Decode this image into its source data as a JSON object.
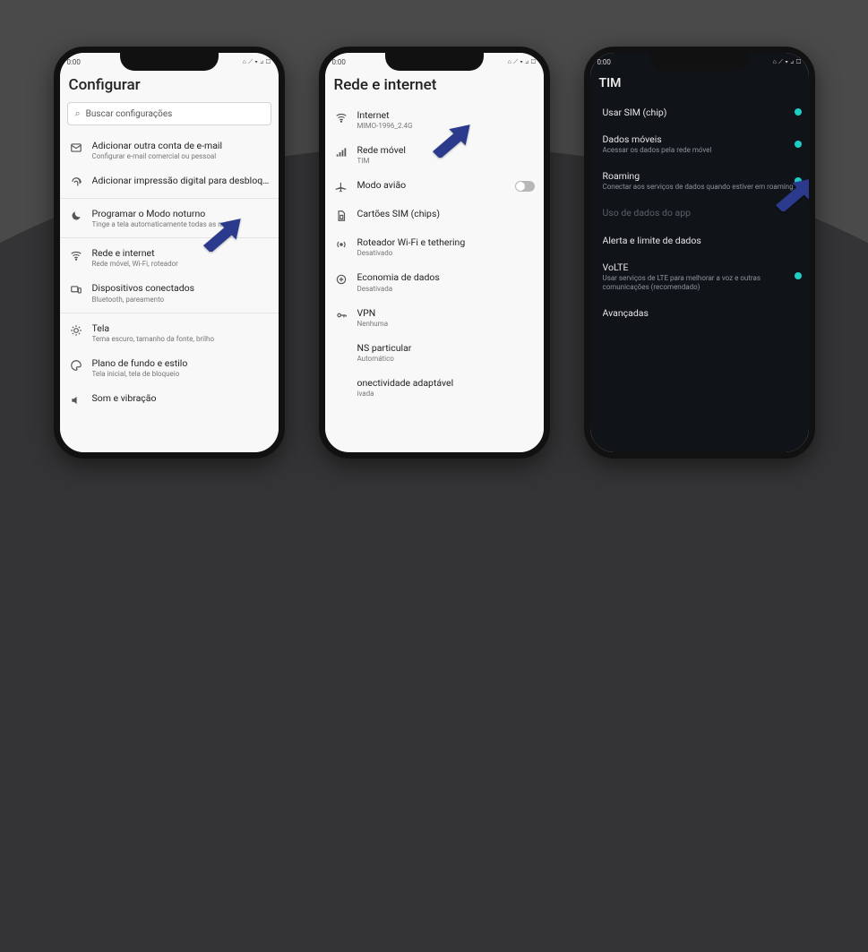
{
  "statusbar": {
    "time": "0:00",
    "indicators": "⌂ ⟋ ▾ ◿ ▢"
  },
  "phone1": {
    "title": "Configurar",
    "search_placeholder": "Buscar configurações",
    "items": [
      {
        "title": "Adicionar outra conta de e-mail",
        "sub": "Configurar e-mail comercial ou pessoal"
      },
      {
        "title": "Adicionar impressão digital para desbloq...",
        "sub": ""
      },
      {
        "title": "Programar o Modo noturno",
        "sub": "Tinge a tela automaticamente todas as noites"
      },
      {
        "title": "Rede e internet",
        "sub": "Rede móvel, Wi-Fi, roteador"
      },
      {
        "title": "Dispositivos conectados",
        "sub": "Bluetooth, pareamento"
      },
      {
        "title": "Tela",
        "sub": "Tema escuro, tamanho da fonte, brilho"
      },
      {
        "title": "Plano de fundo e estilo",
        "sub": "Tela inicial, tela de bloqueio"
      },
      {
        "title": "Som e vibração",
        "sub": ""
      }
    ]
  },
  "phone2": {
    "title": "Rede e internet",
    "items": [
      {
        "title": "Internet",
        "sub": "MIMO-1996_2.4G"
      },
      {
        "title": "Rede móvel",
        "sub": "TIM"
      },
      {
        "title": "Modo avião",
        "sub": ""
      },
      {
        "title": "Cartões SIM (chips)",
        "sub": ""
      },
      {
        "title": "Roteador Wi-Fi e tethering",
        "sub": "Desativado"
      },
      {
        "title": "Economia de dados",
        "sub": "Desativada"
      },
      {
        "title": "VPN",
        "sub": "Nenhuma"
      },
      {
        "title": "NS particular",
        "sub": "Automático"
      },
      {
        "title": "onectividade adaptável",
        "sub": "ivada"
      }
    ]
  },
  "phone3": {
    "title": "TIM",
    "items": [
      {
        "title": "Usar SIM (chip)",
        "sub": ""
      },
      {
        "title": "Dados móveis",
        "sub": "Acessar os dados pela rede móvel"
      },
      {
        "title": "Roaming",
        "sub": "Conectar aos serviços de dados quando estiver em roaming"
      },
      {
        "title": "Uso de dados do app",
        "sub": "",
        "disabled": true
      },
      {
        "title": "Alerta e limite de dados",
        "sub": ""
      },
      {
        "title": "VoLTE",
        "sub": "Usar serviços de LTE para melhorar a voz e outras comunicações (recomendado)"
      },
      {
        "title": "Avançadas",
        "sub": ""
      }
    ]
  },
  "arrow_color": "#2b3a8c"
}
